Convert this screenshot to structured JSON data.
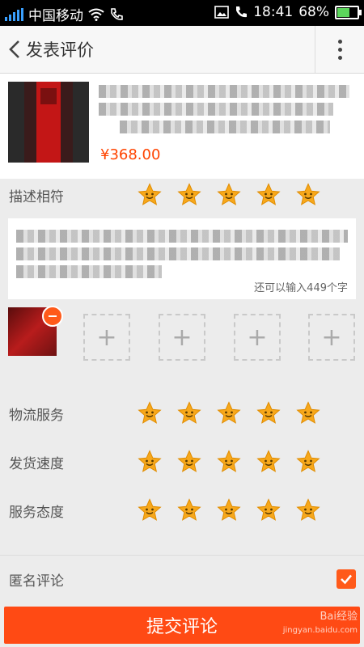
{
  "status_bar": {
    "carrier": "中国移动",
    "time": "18:41",
    "battery_percent": "68%",
    "battery_level": 0.68,
    "icons": [
      "signal-icon",
      "wifi-icon",
      "call-icon",
      "image-icon",
      "phone-icon",
      "battery-icon"
    ]
  },
  "header": {
    "title": "发表评价",
    "back_icon": "chevron-left-icon",
    "menu_icon": "more-vertical-icon"
  },
  "product": {
    "price": "¥368.00"
  },
  "ratings": [
    {
      "label": "描述相符",
      "stars": 5
    },
    {
      "label": "物流服务",
      "stars": 5
    },
    {
      "label": "发货速度",
      "stars": 5
    },
    {
      "label": "服务态度",
      "stars": 5
    }
  ],
  "comment": {
    "counter": "还可以输入449个字"
  },
  "photos": {
    "add_slots": 4,
    "add_symbol": "+"
  },
  "anonymous": {
    "label": "匿名评论",
    "checked": true
  },
  "submit": {
    "label": "提交评论"
  },
  "watermark": {
    "line1": "Bai经验",
    "line2": "jingyan.baidu.com"
  },
  "colors": {
    "accent": "#ff4a14",
    "price": "#ff4400",
    "star": "#f7a81b"
  }
}
